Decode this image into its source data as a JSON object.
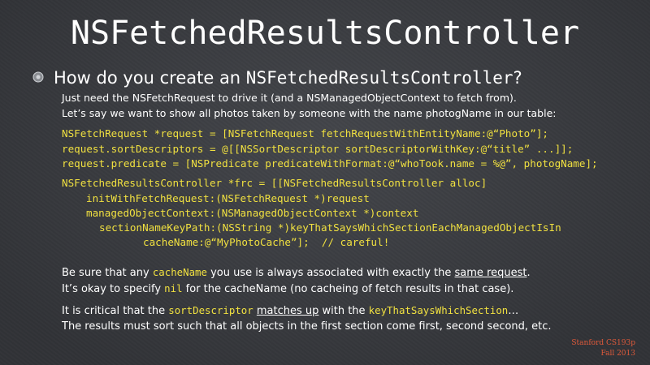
{
  "slide": {
    "title": "NSFetchedResultsController",
    "heading": {
      "prefix": "How do you create an ",
      "code": "NSFetchedResultsController",
      "suffix": "?"
    },
    "intro_lines": [
      "Just need the NSFetchRequest to drive it (and a NSManagedObjectContext to fetch from).",
      "Let’s say we want to show all photos taken by someone with the name photogName in our table:"
    ],
    "code_block_1": [
      "NSFetchRequest *request = [NSFetchRequest fetchRequestWithEntityName:@“Photo”];",
      "request.sortDescriptors = @[[NSSortDescriptor sortDescriptorWithKey:@“title” ...]];",
      "request.predicate = [NSPredicate predicateWithFormat:@“whoTook.name = %@”, photogName];"
    ],
    "code_block_2": [
      "NSFetchedResultsController *frc = [[NSFetchedResultsController alloc]",
      "initWithFetchRequest:(NSFetchRequest *)request",
      "managedObjectContext:(NSManagedObjectContext *)context",
      "sectionNameKeyPath:(NSString *)keyThatSaysWhichSectionEachManagedObjectIsIn",
      "cacheName:@“MyPhotoCache”];  // careful!"
    ],
    "note1": {
      "a": "Be sure that any ",
      "kw": "cacheName",
      "b": " you use is always associated with exactly the ",
      "u": "same request",
      "c": "."
    },
    "note2": {
      "a": "It’s okay to specify ",
      "kw": "nil",
      "b": " for the cacheName (no cacheing of fetch results in that case)."
    },
    "note3": {
      "a": "It is critical that the ",
      "kw1": "sortDescriptor",
      "b": " ",
      "u": "matches up",
      "c": " with the ",
      "kw2": "keyThatSaysWhichSection",
      "d": "…"
    },
    "note4": "The results must sort such that all objects in the first section come first, second second, etc.",
    "footer": [
      "Stanford CS193p",
      "Fall 2013"
    ]
  }
}
